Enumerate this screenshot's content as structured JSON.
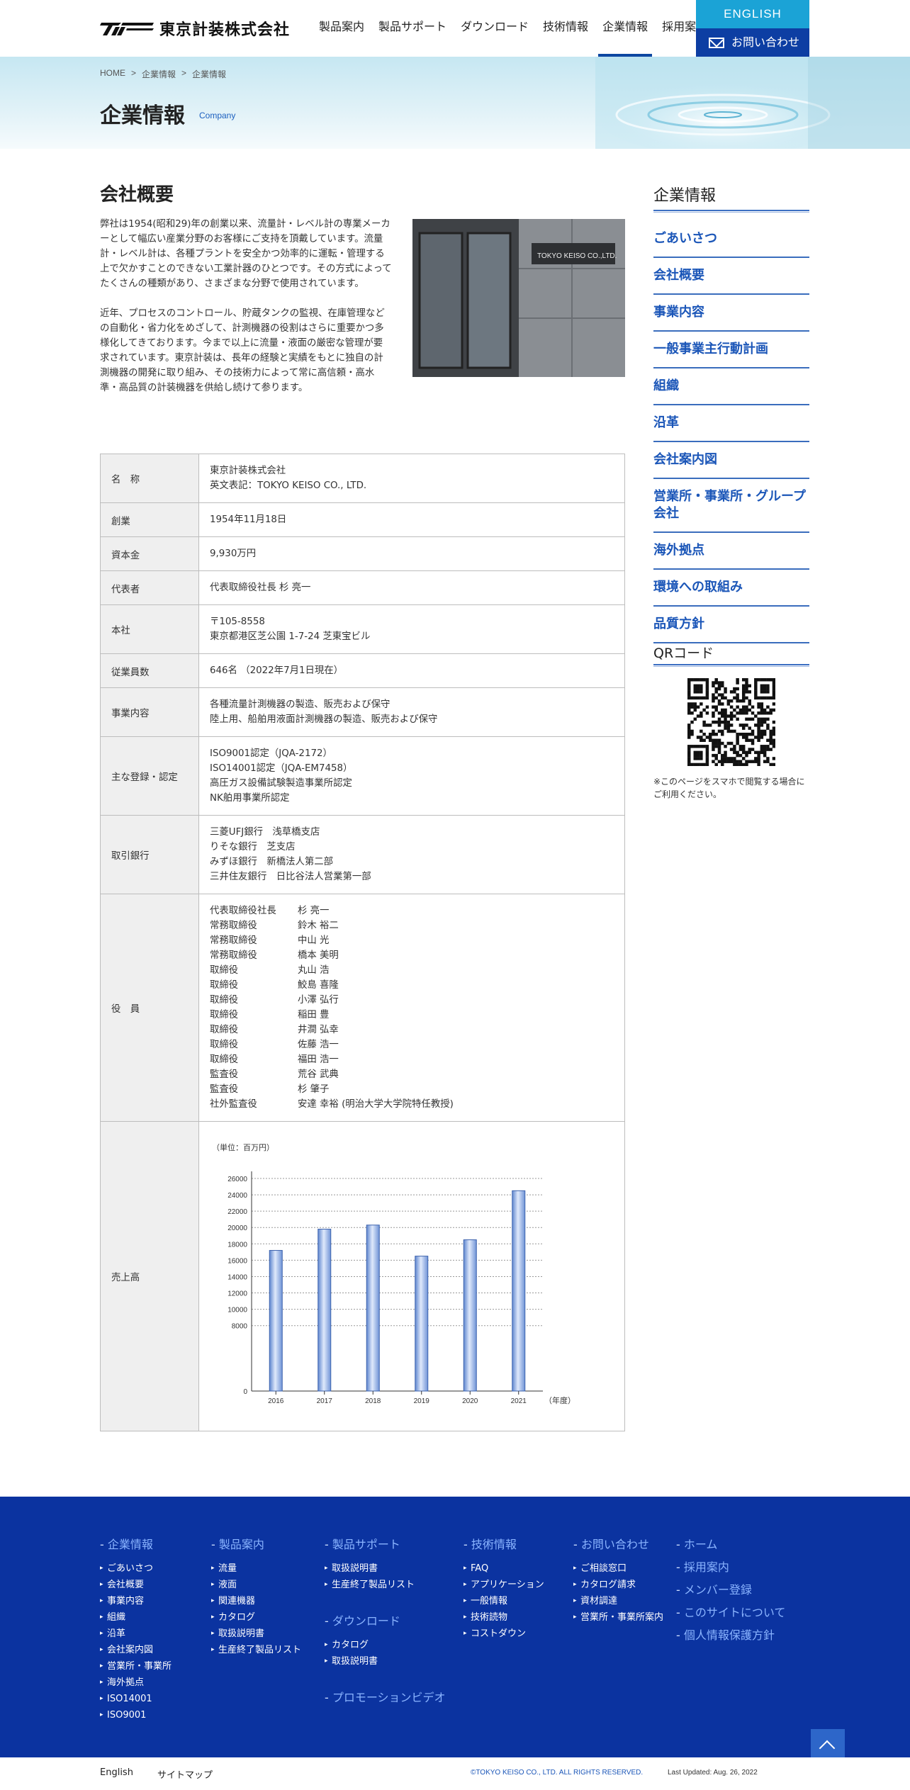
{
  "header": {
    "logo_text": "東京計装株式会社",
    "nav": [
      "製品案内",
      "製品サポート",
      "ダウンロード",
      "技術情報",
      "企業情報",
      "採用案内"
    ],
    "english_label": "ENGLISH",
    "contact_label": "お問い合わせ"
  },
  "hero": {
    "breadcrumb": [
      "HOME",
      ">",
      "企業情報",
      ">",
      "企業情報"
    ],
    "title": "企業情報",
    "subtitle": "Company"
  },
  "main": {
    "section_title": "会社概要",
    "intro_paragraphs": [
      "弊社は1954(昭和29)年の創業以来、流量計・レベル計の専業メーカーとして幅広い産業分野のお客様にご支持を頂戴しています。流量計・レベル計は、各種プラントを安全かつ効率的に運転・管理する上で欠かすことのできない工業計器のひとつです。その方式によってたくさんの種類があり、さまざまな分野で使用されています。",
      "近年、プロセスのコントロール、貯蔵タンクの監視、在庫管理などの自動化・省力化をめざして、計測機器の役割はさらに重要かつ多様化してきております。今まで以上に流量・液面の厳密な管理が要求されています。東京計装は、長年の経験と実績をもとに独自の計測機器の開発に取り組み、その技術力によって常に高信頼・高水準・高品質の計装機器を供給し続けて参ります。"
    ],
    "photo_sign": "TOKYO KEISO CO.,LTD.",
    "table": {
      "rows": [
        {
          "label": "名　称",
          "lines": [
            "東京計装株式会社",
            "英文表記：TOKYO KEISO CO., LTD."
          ]
        },
        {
          "label": "創業",
          "lines": [
            "1954年11月18日"
          ]
        },
        {
          "label": "資本金",
          "lines": [
            "9,930万円"
          ]
        },
        {
          "label": "代表者",
          "lines": [
            "代表取締役社長 杉 亮一"
          ]
        },
        {
          "label": "本社",
          "lines": [
            "〒105-8558",
            "東京都港区芝公園 1-7-24 芝東宝ビル"
          ]
        },
        {
          "label": "従業員数",
          "lines": [
            "646名 （2022年7月1日現在）"
          ]
        },
        {
          "label": "事業内容",
          "lines": [
            "各種流量計測機器の製造、販売および保守",
            "陸上用、船舶用液面計測機器の製造、販売および保守"
          ]
        },
        {
          "label": "主な登録・認定",
          "lines": [
            "ISO9001認定（JQA-2172）",
            "ISO14001認定（JQA-EM7458）",
            "高圧ガス設備試験製造事業所認定",
            "NK舶用事業所認定"
          ]
        },
        {
          "label": "取引銀行",
          "lines": [
            "三菱UFJ銀行　浅草橋支店",
            "りそな銀行　芝支店",
            "みずほ銀行　新橋法人第二部",
            "三井住友銀行　日比谷法人営業第一部"
          ]
        }
      ],
      "officers_label": "役　員",
      "officers": [
        {
          "role": "代表取締役社長",
          "name": "杉 亮一"
        },
        {
          "role": "常務取締役",
          "name": "鈴木 裕二"
        },
        {
          "role": "常務取締役",
          "name": "中山 光"
        },
        {
          "role": "常務取締役",
          "name": "橋本 美明"
        },
        {
          "role": "取締役",
          "name": "丸山 浩"
        },
        {
          "role": "取締役",
          "name": "鮫島 喜隆"
        },
        {
          "role": "取締役",
          "name": "小澤 弘行"
        },
        {
          "role": "取締役",
          "name": "稲田 豊"
        },
        {
          "role": "取締役",
          "name": "井澗 弘幸"
        },
        {
          "role": "取締役",
          "name": "佐藤 浩一"
        },
        {
          "role": "取締役",
          "name": "福田 浩一"
        },
        {
          "role": "監査役",
          "name": "荒谷 武典"
        },
        {
          "role": "監査役",
          "name": "杉 肇子"
        },
        {
          "role": "社外監査役",
          "name": "安達 幸裕 (明治大学大学院特任教授)"
        }
      ],
      "sales_label": "売上高"
    }
  },
  "chart_data": {
    "type": "bar",
    "unit_label": "（単位：百万円）",
    "categories": [
      "2016",
      "2017",
      "2018",
      "2019",
      "2020",
      "2021"
    ],
    "values": [
      17200,
      19800,
      20300,
      16500,
      18500,
      24500
    ],
    "xlabel": "（年度）",
    "ylim": [
      0,
      26000
    ],
    "yticks": [
      "0",
      "8000",
      "10000",
      "12000",
      "14000",
      "16000",
      "18000",
      "20000",
      "22000",
      "24000",
      "26000"
    ],
    "grid": true,
    "bar_color": "#8fb0e6"
  },
  "sidebar": {
    "title": "企業情報",
    "items": [
      "ごあいさつ",
      "会社概要",
      "事業内容",
      "一般事業主行動計画",
      "組織",
      "沿革",
      "会社案内図",
      "営業所・事業所・グループ会社",
      "海外拠点",
      "環境への取組み",
      "品質方針"
    ],
    "qr_title": "QRコード",
    "qr_note": "※このページをスマホで閲覧する場合にご利用ください。"
  },
  "footer": {
    "col1": {
      "head": "企業情報",
      "items": [
        "ごあいさつ",
        "会社概要",
        "事業内容",
        "組織",
        "沿革",
        "会社案内図",
        "営業所・事業所",
        "海外拠点",
        "ISO14001",
        "ISO9001"
      ]
    },
    "col2": {
      "head": "製品案内",
      "items": [
        "流量",
        "液面",
        "関連機器",
        "カタログ",
        "取扱説明書",
        "生産終了製品リスト"
      ]
    },
    "col3": {
      "head": "製品サポート",
      "items": [
        "取扱説明書",
        "生産終了製品リスト"
      ],
      "head2": "ダウンロード",
      "items2": [
        "カタログ",
        "取扱説明書"
      ],
      "head3": "プロモーションビデオ"
    },
    "col4": {
      "head": "技術情報",
      "items": [
        "FAQ",
        "アプリケーション",
        "一般情報",
        "技術読物",
        "コストダウン"
      ]
    },
    "col5": {
      "head": "お問い合わせ",
      "items": [
        "ご相談窓口",
        "カタログ請求",
        "資材調達",
        "営業所・事業所案内"
      ]
    },
    "col6": {
      "items": [
        "ホーム",
        "採用案内",
        "メンバー登録",
        "このサイトについて",
        "個人情報保護方針"
      ]
    },
    "bottom_links": [
      "English",
      "サイトマップ"
    ],
    "copyright": "©TOKYO KEISO CO., LTD. ALL RIGHTS RESERVED.",
    "updated": "Last Updated: Aug. 26, 2022"
  }
}
